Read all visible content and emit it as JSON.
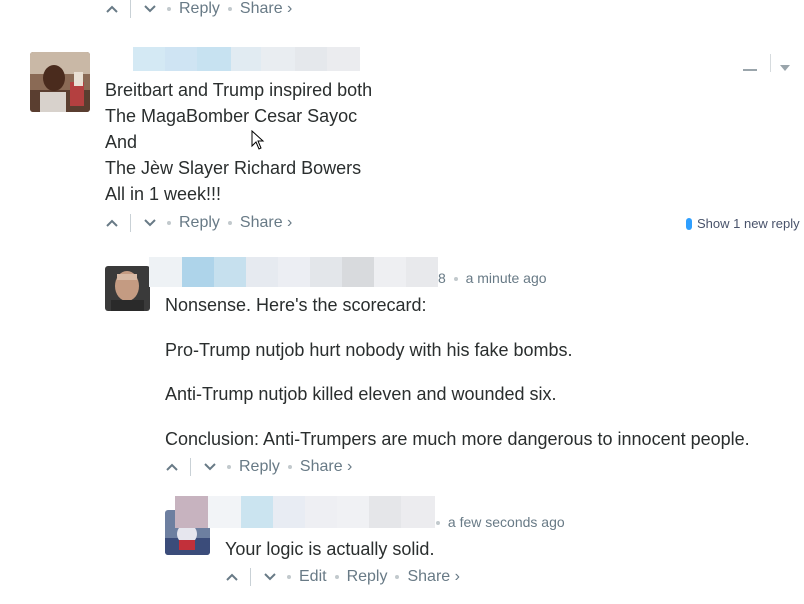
{
  "top_actions": {
    "reply": "Reply",
    "share": "Share ›"
  },
  "comment1": {
    "lines": [
      "Breitbart and Trump inspired both",
      "The MagaBomber Cesar Sayoc",
      "And",
      "The Jèw Slayer Richard Bowers",
      "All in 1 week!!!"
    ],
    "reply": "Reply",
    "share": "Share ›",
    "show_new_reply": "Show 1 new reply"
  },
  "comment2": {
    "username_tail": "8",
    "timestamp": "a minute ago",
    "paragraphs": [
      "Nonsense. Here's the scorecard:",
      "Pro-Trump nutjob hurt nobody with his fake bombs.",
      "Anti-Trump nutjob killed eleven and wounded six.",
      "Conclusion: Anti-Trumpers are much more dangerous to innocent people."
    ],
    "reply": "Reply",
    "share": "Share ›"
  },
  "comment3": {
    "timestamp": "a few seconds ago",
    "text": "Your logic is actually solid.",
    "edit": "Edit",
    "reply": "Reply",
    "share": "Share ›"
  },
  "icons": {
    "upvote": "chevron-up-icon",
    "downvote": "chevron-down-icon",
    "collapse": "minus-icon",
    "menu": "caret-down-icon",
    "cursor": "mouse-pointer-icon"
  },
  "colors": {
    "text": "#2a2e2e",
    "muted": "#687a86",
    "new_reply_pill": "#2e9fff"
  }
}
